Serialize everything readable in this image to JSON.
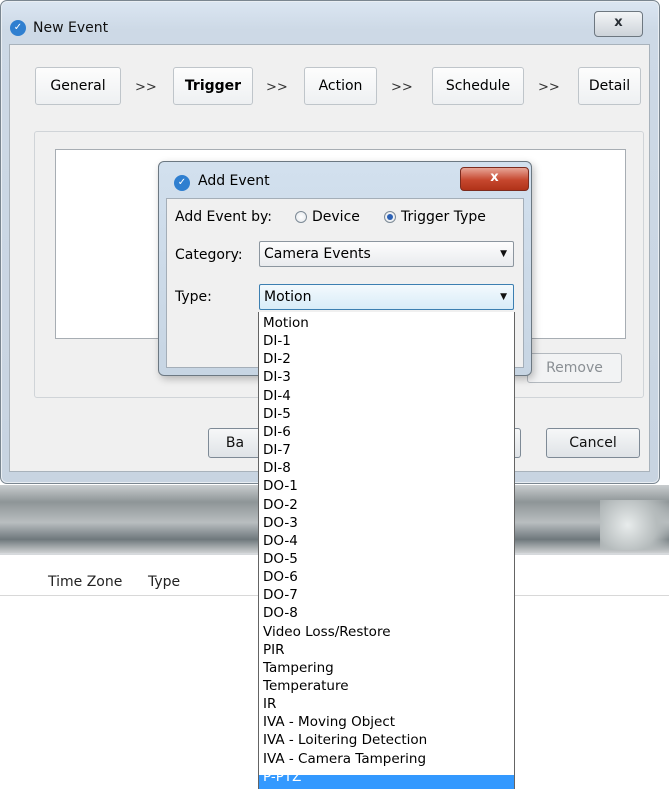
{
  "background": {
    "columns": [
      "Time Zone",
      "Type"
    ]
  },
  "window": {
    "title": "New Event",
    "close_glyph": "x",
    "steps": [
      "General",
      "Trigger",
      "Action",
      "Schedule",
      "Detail"
    ],
    "separator": ">>",
    "active_step": "Trigger",
    "buttons": {
      "remove": "Remove",
      "back": "Ba",
      "cancel": "Cancel"
    }
  },
  "dialog": {
    "title": "Add Event",
    "close_glyph": "x",
    "add_event_by_label": "Add Event by:",
    "radio_device": "Device",
    "radio_trigger_type": "Trigger Type",
    "selected_radio": "Trigger Type",
    "category_label": "Category:",
    "category_value": "Camera Events",
    "type_label": "Type:",
    "type_value": "Motion"
  },
  "dropdown": {
    "options": [
      "Motion",
      "DI-1",
      "DI-2",
      "DI-3",
      "DI-4",
      "DI-5",
      "DI-6",
      "DI-7",
      "DI-8",
      "DO-1",
      "DO-2",
      "DO-3",
      "DO-4",
      "DO-5",
      "DO-6",
      "DO-7",
      "DO-8",
      "Video Loss/Restore",
      "PIR",
      "Tampering",
      "Temperature",
      "IR",
      "IVA - Moving Object",
      "IVA - Loitering Detection",
      "IVA - Camera Tampering",
      "P-PTZ"
    ],
    "highlighted": "P-PTZ"
  },
  "colors": {
    "highlight": "#3399ff",
    "title_gradient": "#cdd9e6",
    "close_red": "#c6472e"
  },
  "icons": [
    "app-logo-icon",
    "close-icon",
    "chevron-down-icon",
    "radio-icon"
  ]
}
